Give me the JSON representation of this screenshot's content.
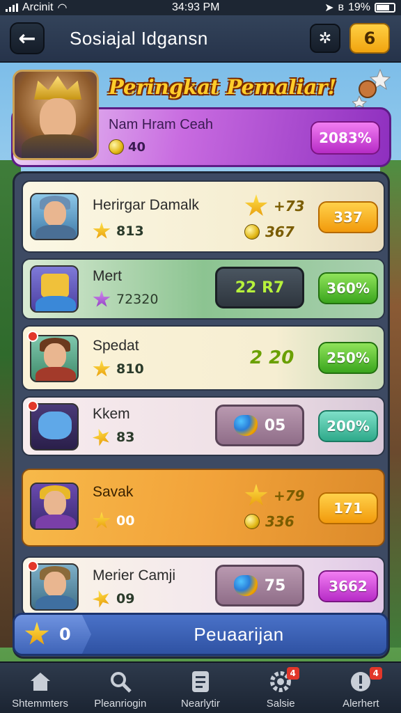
{
  "status_bar": {
    "carrier": "Arcinit",
    "time": "34:93 PM",
    "battery": "19%"
  },
  "header": {
    "title": "Sosiajal Idgansn",
    "level": "6"
  },
  "banner": {
    "heading": "Peringkat Pemaliar!",
    "player_name": "Nam Hram Ceah",
    "coins": "40",
    "score": "2083%"
  },
  "rows": [
    {
      "name": "Herirgar Damalk",
      "stars": "813",
      "stat1": "+73",
      "stat2": "367",
      "button": "337"
    },
    {
      "name": "Mert",
      "stars": "72320",
      "chip": "22 R7",
      "button": "360%"
    },
    {
      "name": "Spedat",
      "stars": "810",
      "extra": "2 20",
      "button": "250%"
    },
    {
      "name": "Kkem",
      "stars": "83",
      "chip": "05",
      "button": "200%"
    },
    {
      "name": "Savak",
      "stars": "00",
      "stat1": "+79",
      "stat2": "336",
      "button": "171"
    },
    {
      "name": "Merier Camji",
      "stars": "09",
      "chip": "75",
      "button": "3662"
    }
  ],
  "footer": {
    "count": "0",
    "title": "Peuaarijan"
  },
  "nav": [
    {
      "label": "Shtemmters",
      "icon": "home-icon"
    },
    {
      "label": "Pleanriogin",
      "icon": "search-icon"
    },
    {
      "label": "Nearlytir",
      "icon": "document-icon",
      "badge": ""
    },
    {
      "label": "Salsie",
      "icon": "gear-icon",
      "badge": "4"
    },
    {
      "label": "Alerhert",
      "icon": "alert-icon",
      "badge": "4"
    }
  ],
  "colors": {
    "accent_purple": "#b62bc6",
    "accent_orange": "#f29a0c",
    "accent_green": "#3aa51d",
    "header_bg": "#2b384e"
  }
}
